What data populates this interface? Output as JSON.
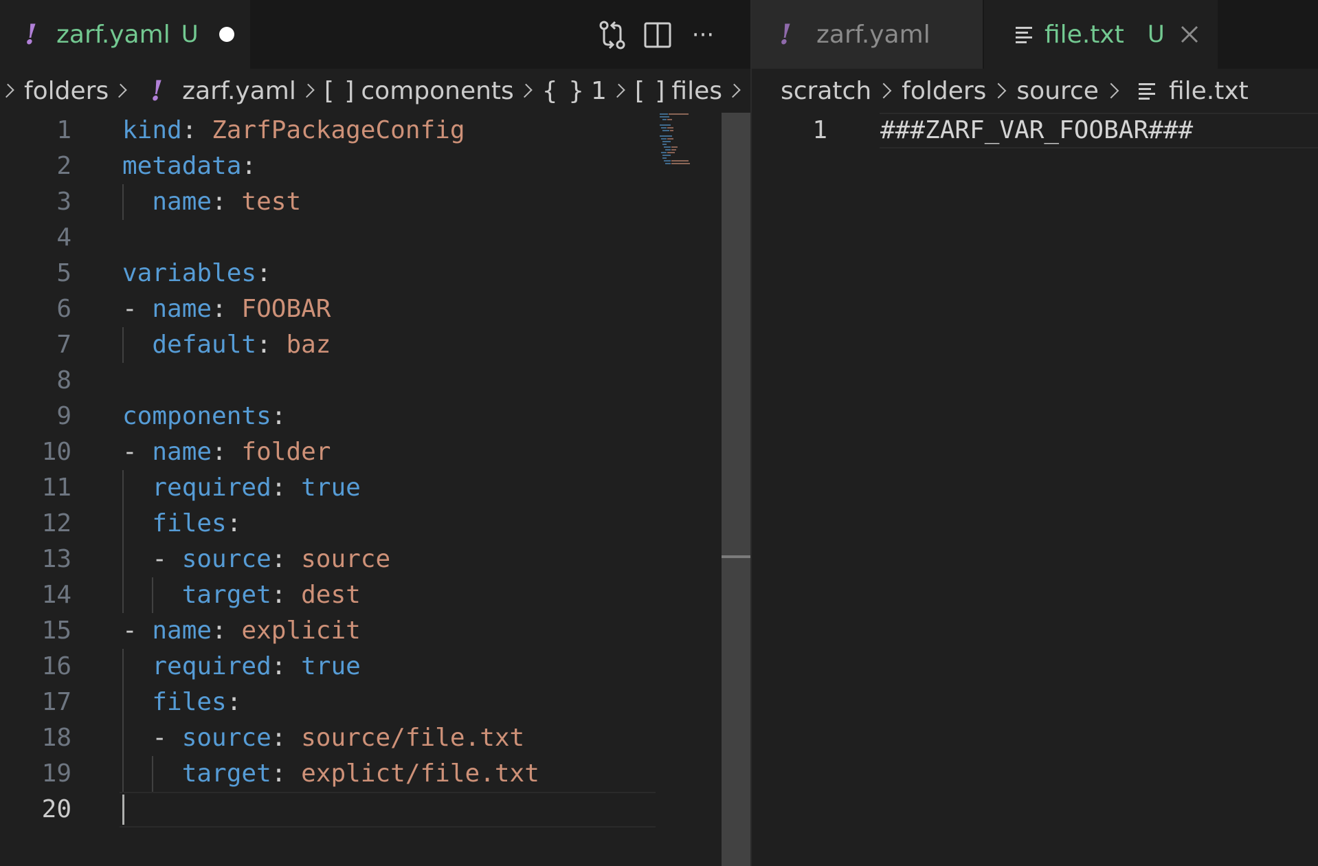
{
  "left_group": {
    "tab": {
      "icon": "yaml-file-icon",
      "label": "zarf.yaml",
      "status": "U"
    },
    "toolbar": {
      "open_changes_icon": "git-compare-icon",
      "split_icon": "split-editor-icon",
      "more_icon": "more-actions-icon",
      "more_label": "···"
    },
    "breadcrumb": {
      "items": [
        "folders",
        "zarf.yaml",
        "components",
        "1",
        "files"
      ],
      "symbols": [
        "",
        "!",
        "[ ]",
        "{ }",
        "[ ]"
      ]
    },
    "code": {
      "lines": [
        {
          "n": "1",
          "tokens": [
            [
              "k",
              "kind"
            ],
            [
              "p",
              ": "
            ],
            [
              "v",
              "ZarfPackageConfig"
            ]
          ]
        },
        {
          "n": "2",
          "tokens": [
            [
              "k",
              "metadata"
            ],
            [
              "p",
              ":"
            ]
          ]
        },
        {
          "n": "3",
          "tokens": [
            [
              "p",
              "  "
            ],
            [
              "k",
              "name"
            ],
            [
              "p",
              ": "
            ],
            [
              "v",
              "test"
            ]
          ]
        },
        {
          "n": "4",
          "tokens": []
        },
        {
          "n": "5",
          "tokens": [
            [
              "k",
              "variables"
            ],
            [
              "p",
              ":"
            ]
          ]
        },
        {
          "n": "6",
          "tokens": [
            [
              "p",
              "- "
            ],
            [
              "k",
              "name"
            ],
            [
              "p",
              ": "
            ],
            [
              "v",
              "FOOBAR"
            ]
          ]
        },
        {
          "n": "7",
          "tokens": [
            [
              "p",
              "  "
            ],
            [
              "k",
              "default"
            ],
            [
              "p",
              ": "
            ],
            [
              "v",
              "baz"
            ]
          ]
        },
        {
          "n": "8",
          "tokens": []
        },
        {
          "n": "9",
          "tokens": [
            [
              "k",
              "components"
            ],
            [
              "p",
              ":"
            ]
          ]
        },
        {
          "n": "10",
          "tokens": [
            [
              "p",
              "- "
            ],
            [
              "k",
              "name"
            ],
            [
              "p",
              ": "
            ],
            [
              "v",
              "folder"
            ]
          ]
        },
        {
          "n": "11",
          "tokens": [
            [
              "p",
              "  "
            ],
            [
              "k",
              "required"
            ],
            [
              "p",
              ": "
            ],
            [
              "k",
              "true"
            ]
          ]
        },
        {
          "n": "12",
          "tokens": [
            [
              "p",
              "  "
            ],
            [
              "k",
              "files"
            ],
            [
              "p",
              ":"
            ]
          ]
        },
        {
          "n": "13",
          "tokens": [
            [
              "p",
              "  - "
            ],
            [
              "k",
              "source"
            ],
            [
              "p",
              ": "
            ],
            [
              "v",
              "source"
            ]
          ]
        },
        {
          "n": "14",
          "tokens": [
            [
              "p",
              "    "
            ],
            [
              "k",
              "target"
            ],
            [
              "p",
              ": "
            ],
            [
              "v",
              "dest"
            ]
          ]
        },
        {
          "n": "15",
          "tokens": [
            [
              "p",
              "- "
            ],
            [
              "k",
              "name"
            ],
            [
              "p",
              ": "
            ],
            [
              "v",
              "explicit"
            ]
          ]
        },
        {
          "n": "16",
          "tokens": [
            [
              "p",
              "  "
            ],
            [
              "k",
              "required"
            ],
            [
              "p",
              ": "
            ],
            [
              "k",
              "true"
            ]
          ]
        },
        {
          "n": "17",
          "tokens": [
            [
              "p",
              "  "
            ],
            [
              "k",
              "files"
            ],
            [
              "p",
              ":"
            ]
          ]
        },
        {
          "n": "18",
          "tokens": [
            [
              "p",
              "  - "
            ],
            [
              "k",
              "source"
            ],
            [
              "p",
              ": "
            ],
            [
              "v",
              "source/file.txt"
            ]
          ]
        },
        {
          "n": "19",
          "tokens": [
            [
              "p",
              "    "
            ],
            [
              "k",
              "target"
            ],
            [
              "p",
              ": "
            ],
            [
              "v",
              "explict/file.txt"
            ]
          ]
        },
        {
          "n": "20",
          "tokens": []
        }
      ],
      "current_line": "20"
    }
  },
  "right_group": {
    "tabs": [
      {
        "icon": "yaml-file-icon",
        "label": "zarf.yaml",
        "active": false
      },
      {
        "icon": "text-file-icon",
        "label": "file.txt",
        "status": "U",
        "active": true,
        "close_icon": "close-icon"
      }
    ],
    "breadcrumb": {
      "items": [
        "scratch",
        "folders",
        "source",
        "file.txt"
      ]
    },
    "code": {
      "lines": [
        {
          "n": "1",
          "text": "###ZARF_VAR_FOOBAR###"
        }
      ]
    }
  },
  "colors": {
    "background": "#1f1f1f",
    "key": "#569cd6",
    "value": "#ce9178",
    "untracked": "#73c991",
    "yaml_icon": "#b180d7"
  }
}
